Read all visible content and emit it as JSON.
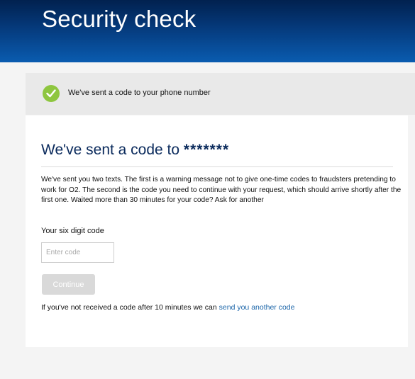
{
  "header": {
    "title": "Security check"
  },
  "notice": {
    "icon": "check-circle-icon",
    "text": "We've sent a code to your phone number",
    "icon_color": "#8ec63f"
  },
  "card": {
    "title_prefix": "We've sent a code to",
    "masked_number": "*******",
    "description": "We've sent you two texts. The first is a warning message not to give one-time codes to fraudsters pretending to work for O2. The second is the code you need to continue with your request, which should arrive shortly after the first one. Waited more than 30 minutes for your code? Ask for another",
    "code_label": "Your six digit code",
    "code_placeholder": "Enter code",
    "code_value": "",
    "continue_label": "Continue",
    "resend_text": "If you've not received a code after 10 minutes we can",
    "resend_link": "send you another code"
  },
  "colors": {
    "header": "#053a7c",
    "title": "#0a2a5c",
    "link": "#1a64a8",
    "button_disabled": "#d9d9d9"
  }
}
